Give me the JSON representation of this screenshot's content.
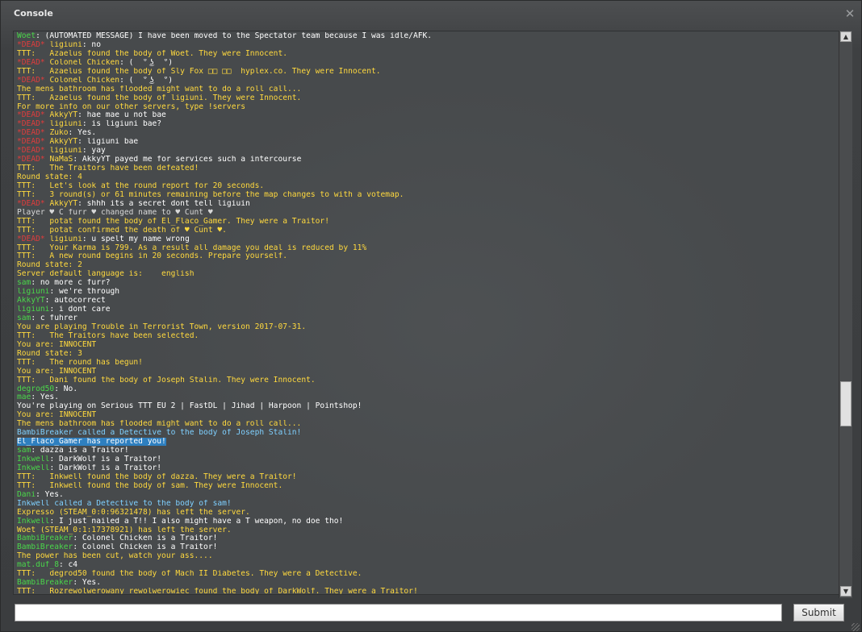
{
  "window": {
    "title": "Console",
    "close_glyph": "✕"
  },
  "colors": {
    "green": "#4ad74a",
    "red": "#e03c3c",
    "yellow": "#ffd93e",
    "white": "#ffffff",
    "default": "#d8d8d8",
    "cyan": "#7fd0ff",
    "selection": "#2e7fbf"
  },
  "log": [
    [
      {
        "t": "Woet",
        "c": "green"
      },
      {
        "t": ": (AUTOMATED MESSAGE) I have been moved to the Spectator team because I was idle/AFK.",
        "c": "white"
      }
    ],
    [
      {
        "t": "*DEAD* ",
        "c": "red"
      },
      {
        "t": "ligiuni",
        "c": "yellow"
      },
      {
        "t": ": no",
        "c": "white"
      }
    ],
    [
      {
        "t": "TTT:   Azaelus found the body of Woet. They were Innocent.",
        "c": "yellow"
      }
    ],
    [
      {
        "t": "*DEAD* ",
        "c": "red"
      },
      {
        "t": "Colonel Chicken",
        "c": "yellow"
      },
      {
        "t": ": ( ͡° ͜ʖ ͡°)",
        "c": "white"
      }
    ],
    [
      {
        "t": "TTT:   Azaelus found the body of Sly Fox □□ □□  hyplex.co. They were Innocent.",
        "c": "yellow"
      }
    ],
    [
      {
        "t": "*DEAD* ",
        "c": "red"
      },
      {
        "t": "Colonel Chicken",
        "c": "yellow"
      },
      {
        "t": ": ( ͡° ͜ʖ ͡°)",
        "c": "white"
      }
    ],
    [
      {
        "t": "The mens bathroom has flooded might want to do a roll call...",
        "c": "yellow"
      }
    ],
    [
      {
        "t": "TTT:   Azaelus found the body of ligiuni. They were Innocent.",
        "c": "yellow"
      }
    ],
    [
      {
        "t": "For more info on our other servers, type !servers",
        "c": "yellow"
      }
    ],
    [
      {
        "t": "*DEAD* ",
        "c": "red"
      },
      {
        "t": "AkkyYT",
        "c": "yellow"
      },
      {
        "t": ": hae mae u not bae",
        "c": "white"
      }
    ],
    [
      {
        "t": "*DEAD* ",
        "c": "red"
      },
      {
        "t": "ligiuni",
        "c": "yellow"
      },
      {
        "t": ": is ligiuni bae?",
        "c": "white"
      }
    ],
    [
      {
        "t": "*DEAD* ",
        "c": "red"
      },
      {
        "t": "Zuko",
        "c": "yellow"
      },
      {
        "t": ": Yes.",
        "c": "white"
      }
    ],
    [
      {
        "t": "*DEAD* ",
        "c": "red"
      },
      {
        "t": "AkkyYT",
        "c": "yellow"
      },
      {
        "t": ": ligiuni bae",
        "c": "white"
      }
    ],
    [
      {
        "t": "*DEAD* ",
        "c": "red"
      },
      {
        "t": "ligiuni",
        "c": "yellow"
      },
      {
        "t": ": yay",
        "c": "white"
      }
    ],
    [
      {
        "t": "*DEAD* ",
        "c": "red"
      },
      {
        "t": "NaMaS",
        "c": "yellow"
      },
      {
        "t": ": AkkyYT payed me for services such a intercourse",
        "c": "white"
      }
    ],
    [
      {
        "t": "TTT:   The Traitors have been defeated!",
        "c": "yellow"
      }
    ],
    [
      {
        "t": "Round state: 4",
        "c": "yellow"
      }
    ],
    [
      {
        "t": "TTT:   Let's look at the round report for 20 seconds.",
        "c": "yellow"
      }
    ],
    [
      {
        "t": "TTT:   3 round(s) or 61 minutes remaining before the map changes to with a votemap.",
        "c": "yellow"
      }
    ],
    [
      {
        "t": "*DEAD* ",
        "c": "red"
      },
      {
        "t": "AkkyYT",
        "c": "yellow"
      },
      {
        "t": ": shhh its a secret dont tell ligiuin",
        "c": "white"
      }
    ],
    [
      {
        "t": "Player ♥ C furr ♥ changed name to ♥ Cunt ♥",
        "c": "default"
      }
    ],
    [
      {
        "t": "TTT:   potat found the body of El_Flaco_Gamer. They were a Traitor!",
        "c": "yellow"
      }
    ],
    [
      {
        "t": "TTT:   potat confirmed the death of ♥ Cunt ♥.",
        "c": "yellow"
      }
    ],
    [
      {
        "t": "*DEAD* ",
        "c": "red"
      },
      {
        "t": "ligiuni",
        "c": "yellow"
      },
      {
        "t": ": u spelt my name wrong",
        "c": "white"
      }
    ],
    [
      {
        "t": "TTT:   Your Karma is 799. As a result all damage you deal is reduced by 11%",
        "c": "yellow"
      }
    ],
    [
      {
        "t": "TTT:   A new round begins in 20 seconds. Prepare yourself.",
        "c": "yellow"
      }
    ],
    [
      {
        "t": "Round state: 2",
        "c": "yellow"
      }
    ],
    [
      {
        "t": "Server default language is:    english",
        "c": "yellow"
      }
    ],
    [
      {
        "t": "sam",
        "c": "green"
      },
      {
        "t": ": no more c furr?",
        "c": "white"
      }
    ],
    [
      {
        "t": "ligiuni",
        "c": "green"
      },
      {
        "t": ": we're through",
        "c": "white"
      }
    ],
    [
      {
        "t": "AkkyYT",
        "c": "green"
      },
      {
        "t": ": autocorrect",
        "c": "white"
      }
    ],
    [
      {
        "t": "ligiuni",
        "c": "green"
      },
      {
        "t": ": i dont care",
        "c": "white"
      }
    ],
    [
      {
        "t": "sam",
        "c": "green"
      },
      {
        "t": ": c fuhrer",
        "c": "white"
      }
    ],
    [
      {
        "t": "You are playing Trouble in Terrorist Town, version 2017-07-31.",
        "c": "yellow"
      }
    ],
    [
      {
        "t": "TTT:   The Traitors have been selected.",
        "c": "yellow"
      }
    ],
    [
      {
        "t": "You are: INNOCENT",
        "c": "yellow"
      }
    ],
    [
      {
        "t": "Round state: 3",
        "c": "yellow"
      }
    ],
    [
      {
        "t": "TTT:   The round has begun!",
        "c": "yellow"
      }
    ],
    [
      {
        "t": "You are: INNOCENT",
        "c": "yellow"
      }
    ],
    [
      {
        "t": "TTT:   Dani found the body of Joseph Stalin. They were Innocent.",
        "c": "yellow"
      }
    ],
    [
      {
        "t": "degrod50",
        "c": "green"
      },
      {
        "t": ": No.",
        "c": "white"
      }
    ],
    [
      {
        "t": "mae",
        "c": "green"
      },
      {
        "t": ": Yes.",
        "c": "white"
      }
    ],
    [
      {
        "t": "You're playing on Serious TTT EU 2 | FastDL | Jihad | Harpoon | Pointshop!",
        "c": "white"
      }
    ],
    [
      {
        "t": "You are: INNOCENT",
        "c": "yellow"
      }
    ],
    [
      {
        "t": "The mens bathroom has flooded might want to do a roll call...",
        "c": "yellow"
      }
    ],
    [
      {
        "t": "BambiBreaker called a Detective to the body of Joseph Stalin!",
        "c": "cyan"
      }
    ],
    [
      {
        "t": "El_Flaco_Gamer has reported you!",
        "c": "white",
        "sel": true
      }
    ],
    [
      {
        "t": "sam",
        "c": "green"
      },
      {
        "t": ": dazza is a Traitor!",
        "c": "white"
      }
    ],
    [
      {
        "t": "Inkwell",
        "c": "green"
      },
      {
        "t": ": DarkWolf is a Traitor!",
        "c": "white"
      }
    ],
    [
      {
        "t": "Inkwell",
        "c": "green"
      },
      {
        "t": ": DarkWolf is a Traitor!",
        "c": "white"
      }
    ],
    [
      {
        "t": "TTT:   Inkwell found the body of dazza. They were a Traitor!",
        "c": "yellow"
      }
    ],
    [
      {
        "t": "TTT:   Inkwell found the body of sam. They were Innocent.",
        "c": "yellow"
      }
    ],
    [
      {
        "t": "Dani",
        "c": "green"
      },
      {
        "t": ": Yes.",
        "c": "white"
      }
    ],
    [
      {
        "t": "Inkwell called a Detective to the body of sam!",
        "c": "cyan"
      }
    ],
    [
      {
        "t": "Expresso (STEAM_0:0:96321478) has left the server.",
        "c": "yellow"
      }
    ],
    [
      {
        "t": "Inkwell",
        "c": "green"
      },
      {
        "t": ": I just nailed a T!! I also might have a T weapon, no doe tho!",
        "c": "white"
      }
    ],
    [
      {
        "t": "Woet (STEAM_0:1:17378921) has left the server.",
        "c": "yellow"
      }
    ],
    [
      {
        "t": "BambiBreaker",
        "c": "green"
      },
      {
        "t": ": Colonel Chicken is a Traitor!",
        "c": "white"
      }
    ],
    [
      {
        "t": "BambiBreaker",
        "c": "green"
      },
      {
        "t": ": Colonel Chicken is a Traitor!",
        "c": "white"
      }
    ],
    [
      {
        "t": "The power has been cut, watch your ass....",
        "c": "yellow"
      }
    ],
    [
      {
        "t": "mat.duf_8",
        "c": "green"
      },
      {
        "t": ": c4",
        "c": "white"
      }
    ],
    [
      {
        "t": "TTT:   degrod50 found the body of Mach II Diabetes. They were a Detective.",
        "c": "yellow"
      }
    ],
    [
      {
        "t": "BambiBreaker",
        "c": "green"
      },
      {
        "t": ": Yes.",
        "c": "white"
      }
    ],
    [
      {
        "t": "TTT:   Rozrewolwerowany rewolwerowiec found the body of DarkWolf. They were a Traitor!",
        "c": "yellow"
      }
    ]
  ],
  "scrollbar": {
    "up_glyph": "▲",
    "down_glyph": "▼",
    "position": 0.62
  },
  "input": {
    "value": "",
    "placeholder": ""
  },
  "submit": {
    "label": "Submit"
  }
}
